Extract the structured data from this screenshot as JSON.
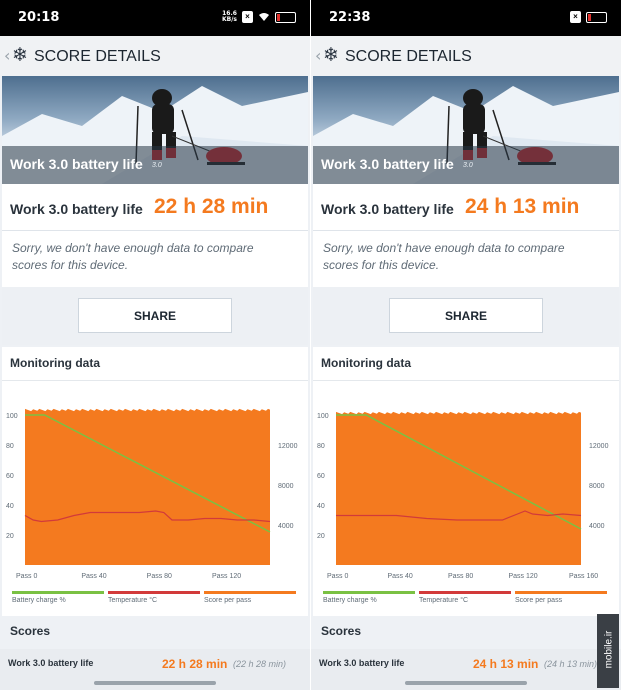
{
  "panels": [
    {
      "time": "20:18",
      "netspeed_value": "16.6",
      "netspeed_unit": "KB/s",
      "header_title": "SCORE DETAILS",
      "hero_title": "Work 3.0 battery life",
      "hero_badge": "3.0",
      "score_label": "Work 3.0 battery life",
      "score_value": "22 h 28 min",
      "sorry_text": "Sorry, we don't have enough data to compare scores for this device.",
      "share_label": "SHARE",
      "monitoring_title": "Monitoring data",
      "scores_title": "Scores",
      "row_label": "Work 3.0 battery life",
      "row_value": "22 h 28 min",
      "row_sub": "(22 h 28 min)",
      "chart_data": {
        "type": "line",
        "x_ticks": [
          "Pass 0",
          "Pass 40",
          "Pass 80",
          "Pass 120"
        ],
        "x_range": [
          0,
          150
        ],
        "y_left_ticks": [
          "100",
          "80",
          "60",
          "40",
          "20"
        ],
        "y_left_range": [
          0,
          100
        ],
        "y_right_ticks": [
          "12000",
          "8000",
          "4000"
        ],
        "y_right_range": [
          0,
          16000
        ],
        "series": [
          {
            "name": "Battery charge %",
            "color": "#7ac143",
            "x": [
              0,
              12,
              150
            ],
            "y": [
              100,
              100,
              22
            ]
          },
          {
            "name": "Temperature °C",
            "color": "#d23a3a",
            "x": [
              0,
              5,
              10,
              20,
              30,
              40,
              50,
              60,
              70,
              80,
              85,
              90,
              100,
              110,
              120,
              130,
              140,
              150
            ],
            "y": [
              33,
              30,
              29,
              30,
              33,
              35,
              35,
              35,
              35,
              36,
              35,
              30,
              30,
              31,
              31,
              30,
              30,
              29
            ]
          },
          {
            "name": "Score per pass",
            "color": "#f47a1f",
            "type": "area",
            "approx_level": 15500
          }
        ]
      }
    },
    {
      "time": "22:38",
      "netspeed_value": "",
      "netspeed_unit": "",
      "header_title": "SCORE DETAILS",
      "hero_title": "Work 3.0 battery life",
      "hero_badge": "3.0",
      "score_label": "Work 3.0 battery life",
      "score_value": "24 h 13 min",
      "sorry_text": "Sorry, we don't have enough data to compare scores for this device.",
      "share_label": "SHARE",
      "monitoring_title": "Monitoring data",
      "scores_title": "Scores",
      "row_label": "Work 3.0 battery life",
      "row_value": "24 h 13 min",
      "row_sub": "(24 h 13 min)",
      "chart_data": {
        "type": "line",
        "x_ticks": [
          "Pass 0",
          "Pass 40",
          "Pass 80",
          "Pass 120",
          "Pass 160"
        ],
        "x_range": [
          0,
          162
        ],
        "y_left_ticks": [
          "100",
          "80",
          "60",
          "40",
          "20"
        ],
        "y_left_range": [
          0,
          100
        ],
        "y_right_ticks": [
          "12000",
          "8000",
          "4000"
        ],
        "y_right_range": [
          0,
          16000
        ],
        "series": [
          {
            "name": "Battery charge %",
            "color": "#7ac143",
            "x": [
              0,
              20,
              162
            ],
            "y": [
              100,
              100,
              24
            ]
          },
          {
            "name": "Temperature °C",
            "color": "#d23a3a",
            "x": [
              0,
              10,
              20,
              40,
              60,
              80,
              100,
              110,
              120,
              125,
              130,
              140,
              150,
              162
            ],
            "y": [
              33,
              33,
              33,
              33,
              31,
              30,
              30,
              30,
              34,
              36,
              34,
              33,
              34,
              33
            ]
          },
          {
            "name": "Score per pass",
            "color": "#f47a1f",
            "type": "area",
            "approx_level": 15200
          }
        ]
      }
    }
  ],
  "legend": [
    "Battery charge %",
    "Temperature °C",
    "Score per pass"
  ],
  "colors": {
    "accent": "#f47a1f",
    "battery": "#7ac143",
    "temperature": "#d23a3a"
  },
  "watermark": "mobile.ir"
}
